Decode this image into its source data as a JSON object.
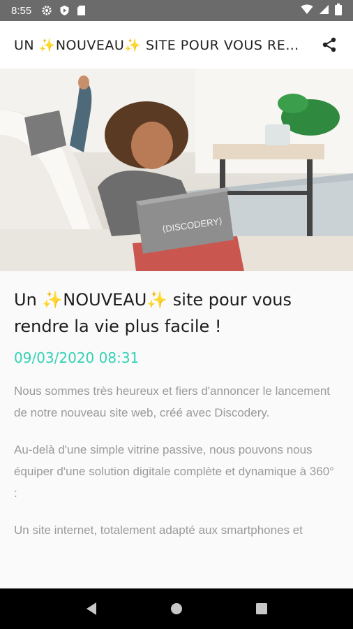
{
  "status_bar": {
    "time": "8:55",
    "left_icons": [
      "settings-icon",
      "shield-icon",
      "sd-card-icon"
    ],
    "right_icons": [
      "wifi-icon",
      "signal-icon",
      "battery-icon"
    ]
  },
  "app_bar": {
    "title": "UN ✨NOUVEAU✨ SITE POUR VOUS RENDRE LA VIE PLUS FACILE !",
    "share_icon": "share-icon"
  },
  "hero": {
    "laptop_logo": "⟨DISCODERY⟩",
    "accent_plant": "#2f8a3f"
  },
  "article": {
    "title": "Un ✨NOUVEAU✨ site pour vous rendre la vie plus facile !",
    "date": "09/03/2020 08:31",
    "date_color": "#33d1b6",
    "paragraphs": [
      "Nous sommes très heureux et fiers d'annoncer le lancement de notre nouveau site web, créé avec Discodery.",
      "Au-delà d'une simple vitrine passive, nous pouvons nous équiper d'une solution digitale complète et dynamique à 360° :",
      "Un site internet, totalement adapté aux smartphones et"
    ]
  },
  "nav_bar": {
    "buttons": [
      "back-icon",
      "home-icon",
      "recents-icon"
    ]
  }
}
